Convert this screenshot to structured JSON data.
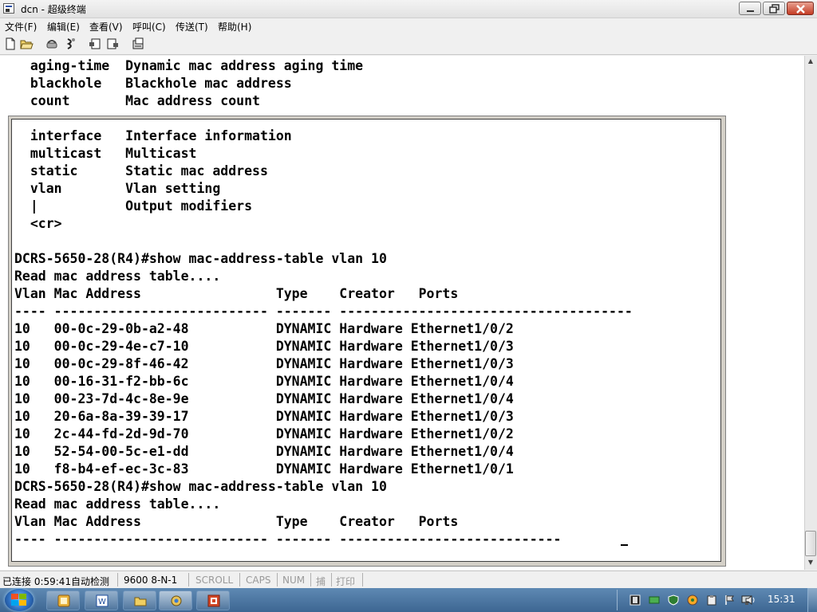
{
  "window": {
    "title": "dcn - 超级终端"
  },
  "menu": [
    "文件(F)",
    "编辑(E)",
    "查看(V)",
    "呼叫(C)",
    "传送(T)",
    "帮助(H)"
  ],
  "toolbar": {
    "icons": [
      "new-file-icon",
      "open-folder-icon",
      "phone-icon",
      "disconnect-icon",
      "send-icon",
      "receive-icon",
      "properties-icon"
    ]
  },
  "terminal": {
    "background_lines": [
      "  aging-time  Dynamic mac address aging time",
      "  blackhole   Blackhole mac address",
      "  count       Mac address count"
    ],
    "lines": [
      "  interface   Interface information",
      "  multicast   Multicast",
      "  static      Static mac address",
      "  vlan        Vlan setting",
      "  |           Output modifiers",
      "  <cr>",
      "",
      "DCRS-5650-28(R4)#show mac-address-table vlan 10",
      "Read mac address table....",
      "Vlan Mac Address                 Type    Creator   Ports",
      "---- --------------------------- ------- -------------------------------------",
      "10   00-0c-29-0b-a2-48           DYNAMIC Hardware Ethernet1/0/2",
      "10   00-0c-29-4e-c7-10           DYNAMIC Hardware Ethernet1/0/3",
      "10   00-0c-29-8f-46-42           DYNAMIC Hardware Ethernet1/0/3",
      "10   00-16-31-f2-bb-6c           DYNAMIC Hardware Ethernet1/0/4",
      "10   00-23-7d-4c-8e-9e           DYNAMIC Hardware Ethernet1/0/4",
      "10   20-6a-8a-39-39-17           DYNAMIC Hardware Ethernet1/0/3",
      "10   2c-44-fd-2d-9d-70           DYNAMIC Hardware Ethernet1/0/2",
      "10   52-54-00-5c-e1-dd           DYNAMIC Hardware Ethernet1/0/4",
      "10   f8-b4-ef-ec-3c-83           DYNAMIC Hardware Ethernet1/0/1",
      "DCRS-5650-28(R4)#show mac-address-table vlan 10",
      "Read mac address table....",
      "Vlan Mac Address                 Type    Creator   Ports",
      "---- --------------------------- ------- ----------------------------"
    ]
  },
  "status": {
    "connection": "已连接 0:59:41",
    "detect": "自动检测",
    "port_settings": "9600 8-N-1",
    "scroll": "SCROLL",
    "caps": "CAPS",
    "num": "NUM",
    "capture": "捕",
    "print": "打印"
  },
  "taskbar": {
    "buttons": [
      "ie-icon",
      "word-icon",
      "explorer-icon",
      "hyperterminal-icon",
      "powerpoint-icon"
    ],
    "tray_icons": [
      "film-icon",
      "network-icon",
      "shield-icon",
      "security-icon",
      "clipboard-icon",
      "flag-icon",
      "monitor-icon",
      "volume-icon"
    ],
    "clock": "15:31"
  },
  "colors": {
    "titlebar": "#e8e8e8",
    "terminal_bg": "#ffffff",
    "taskbar": "#4a74a0",
    "close_button": "#c43c24"
  }
}
